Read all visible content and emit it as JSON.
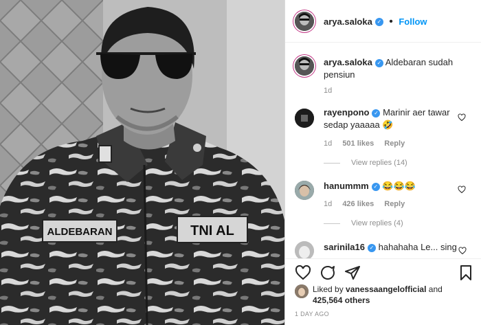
{
  "post": {
    "author": "arya.saloka",
    "follow_label": "Follow",
    "separator": "•",
    "photo_text": {
      "name_tag": "ALDEBARAN",
      "unit_tag": "TNI AL"
    }
  },
  "caption": {
    "username": "arya.saloka",
    "text": "Aldebaran sudah pensiun",
    "age": "1d"
  },
  "comments": [
    {
      "username": "rayenpono",
      "text": "Marinir aer tawar sedap yaaaaa",
      "emoji": "🤣",
      "age": "1d",
      "likes": "501 likes",
      "reply_label": "Reply",
      "view_replies": "View replies (14)"
    },
    {
      "username": "hanummm",
      "text": "",
      "emoji": "😂😂😂",
      "age": "1d",
      "likes": "426 likes",
      "reply_label": "Reply",
      "view_replies": "View replies (4)"
    },
    {
      "username": "sarinila16",
      "text": "hahahaha Le... sing"
    }
  ],
  "likes_summary": {
    "prefix": "Liked by",
    "user": "vanessaangelofficial",
    "and": "and",
    "count": "425,564 others"
  },
  "timestamp": "1 DAY AGO",
  "icons": [
    "heart-icon",
    "comment-icon",
    "share-icon",
    "bookmark-icon",
    "verified-badge-icon"
  ],
  "colors": {
    "accent": "#0095f6",
    "verified": "#3897f0",
    "text": "#262626",
    "muted": "#8e8e8e"
  }
}
